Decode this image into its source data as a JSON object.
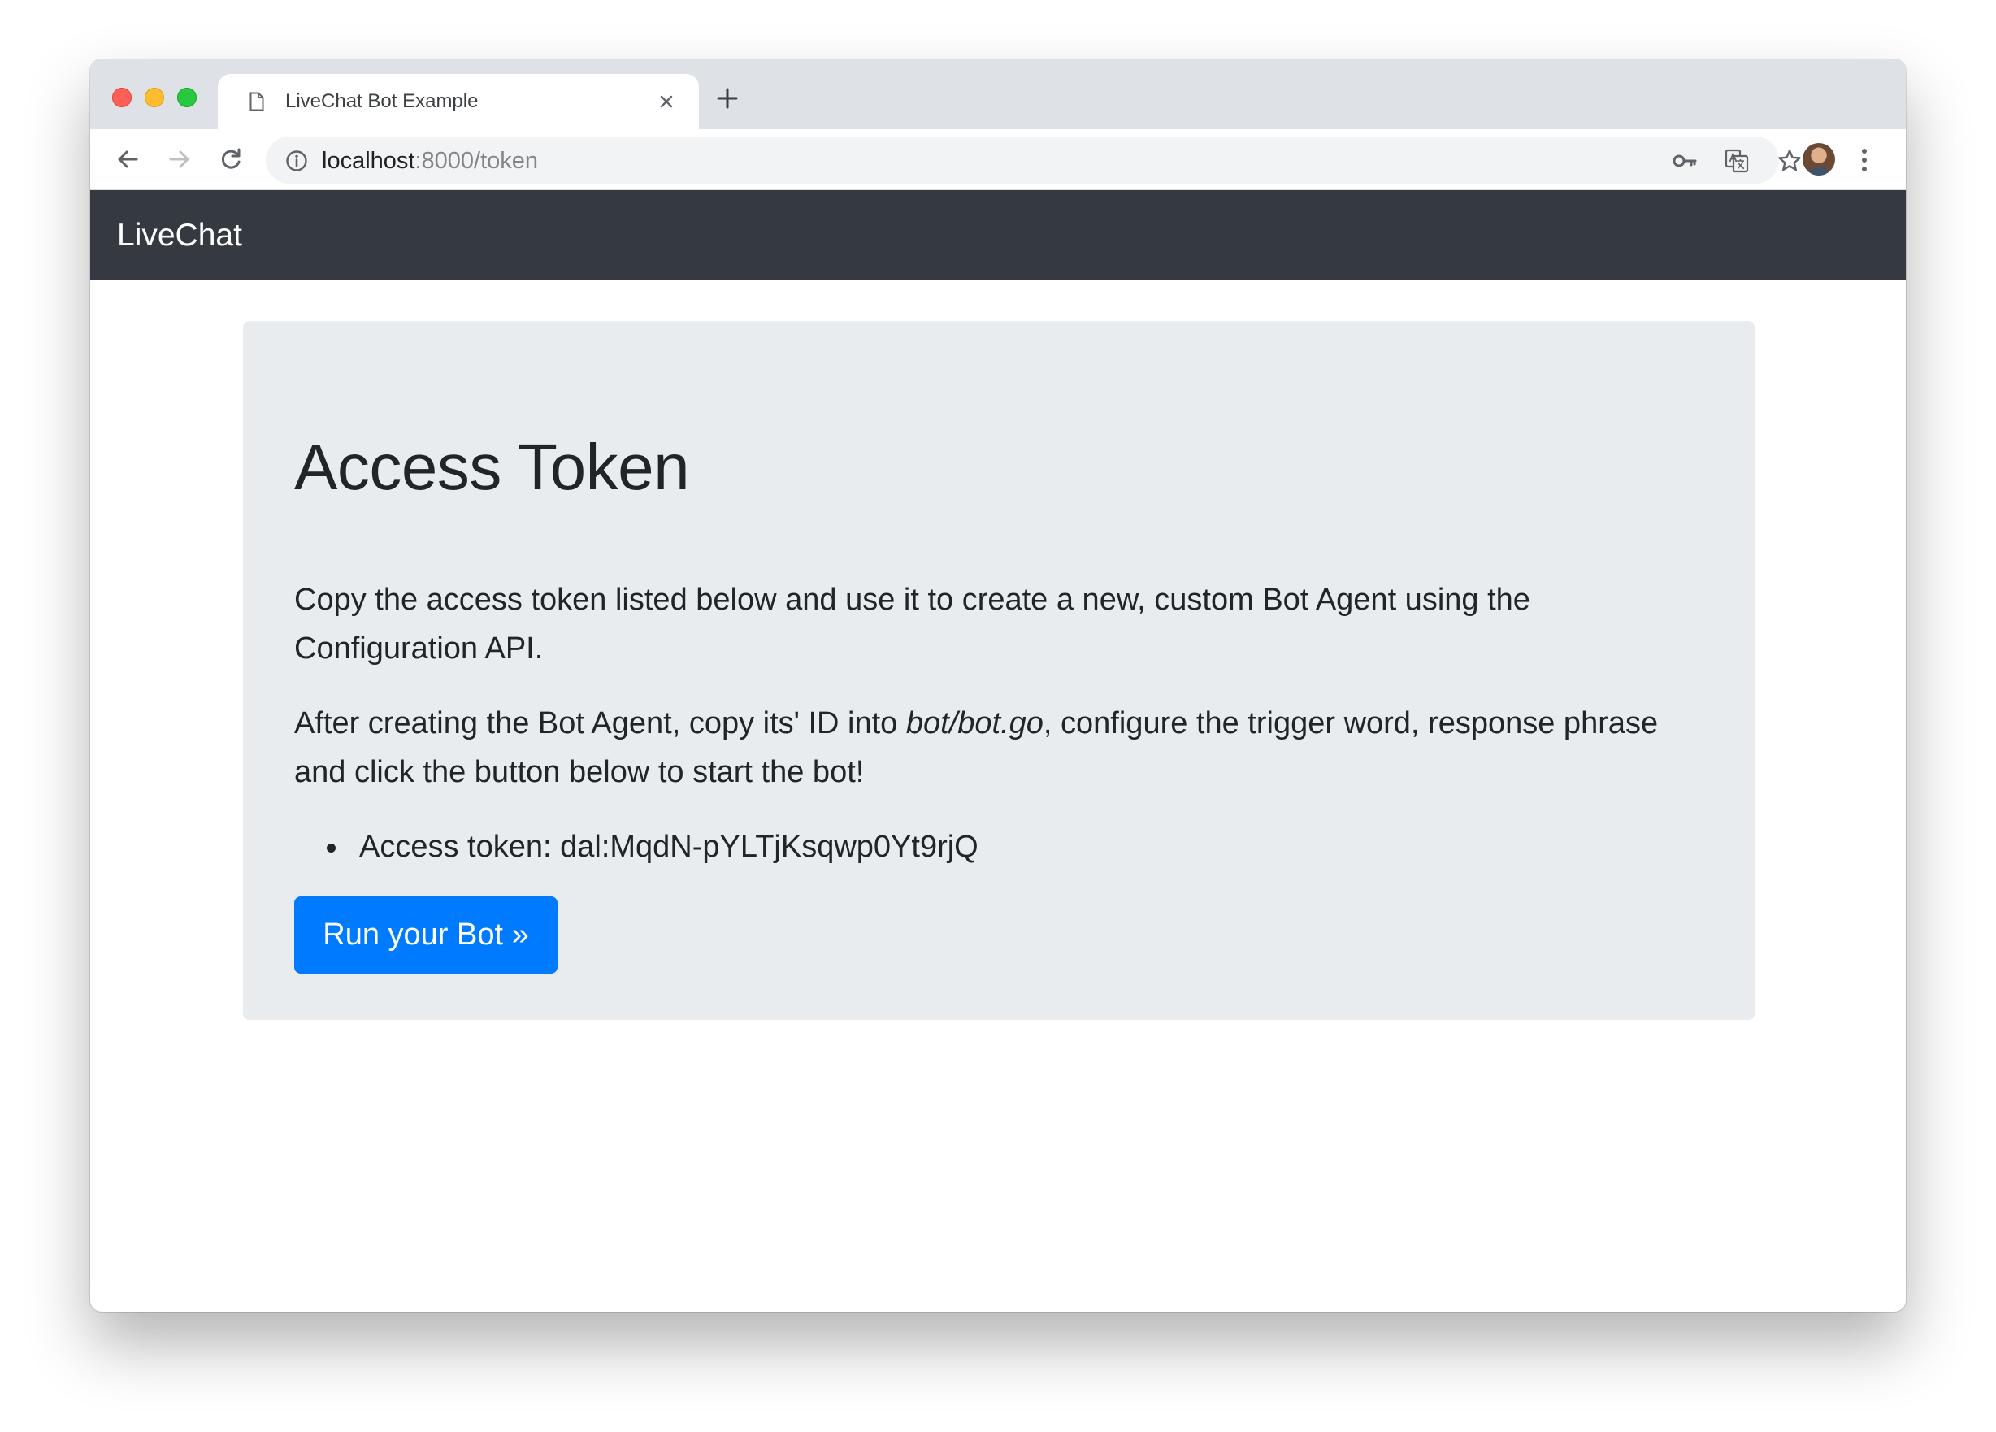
{
  "browser": {
    "tab_title": "LiveChat Bot Example",
    "url_host": "localhost",
    "url_path": ":8000/token"
  },
  "icons": {
    "tab": "document-icon",
    "close": "close-icon",
    "new_tab": "plus-icon",
    "back": "back-arrow-icon",
    "forward": "forward-arrow-icon",
    "reload": "reload-icon",
    "site_info": "info-icon",
    "passwords": "key-icon",
    "translate": "translate-icon",
    "bookmark": "star-icon",
    "menu": "more-vertical-icon"
  },
  "navbar": {
    "brand": "LiveChat"
  },
  "jumbotron": {
    "title": "Access Token",
    "paragraph1": "Copy the access token listed below and use it to create a new, custom Bot Agent using the Configuration API.",
    "paragraph2_before": "After creating the Bot Agent, copy its' ID into ",
    "paragraph2_file": "bot/bot.go",
    "paragraph2_after": ", configure the trigger word, response phrase and click the button below to start the bot!",
    "token_item": "Access token: dal:MqdN-pYLTjKsqwp0Yt9rjQ",
    "button_label": "Run your Bot »"
  },
  "colors": {
    "navbar_bg": "#343a40",
    "jumbotron_bg": "#e9ecef",
    "primary": "#007bff"
  }
}
